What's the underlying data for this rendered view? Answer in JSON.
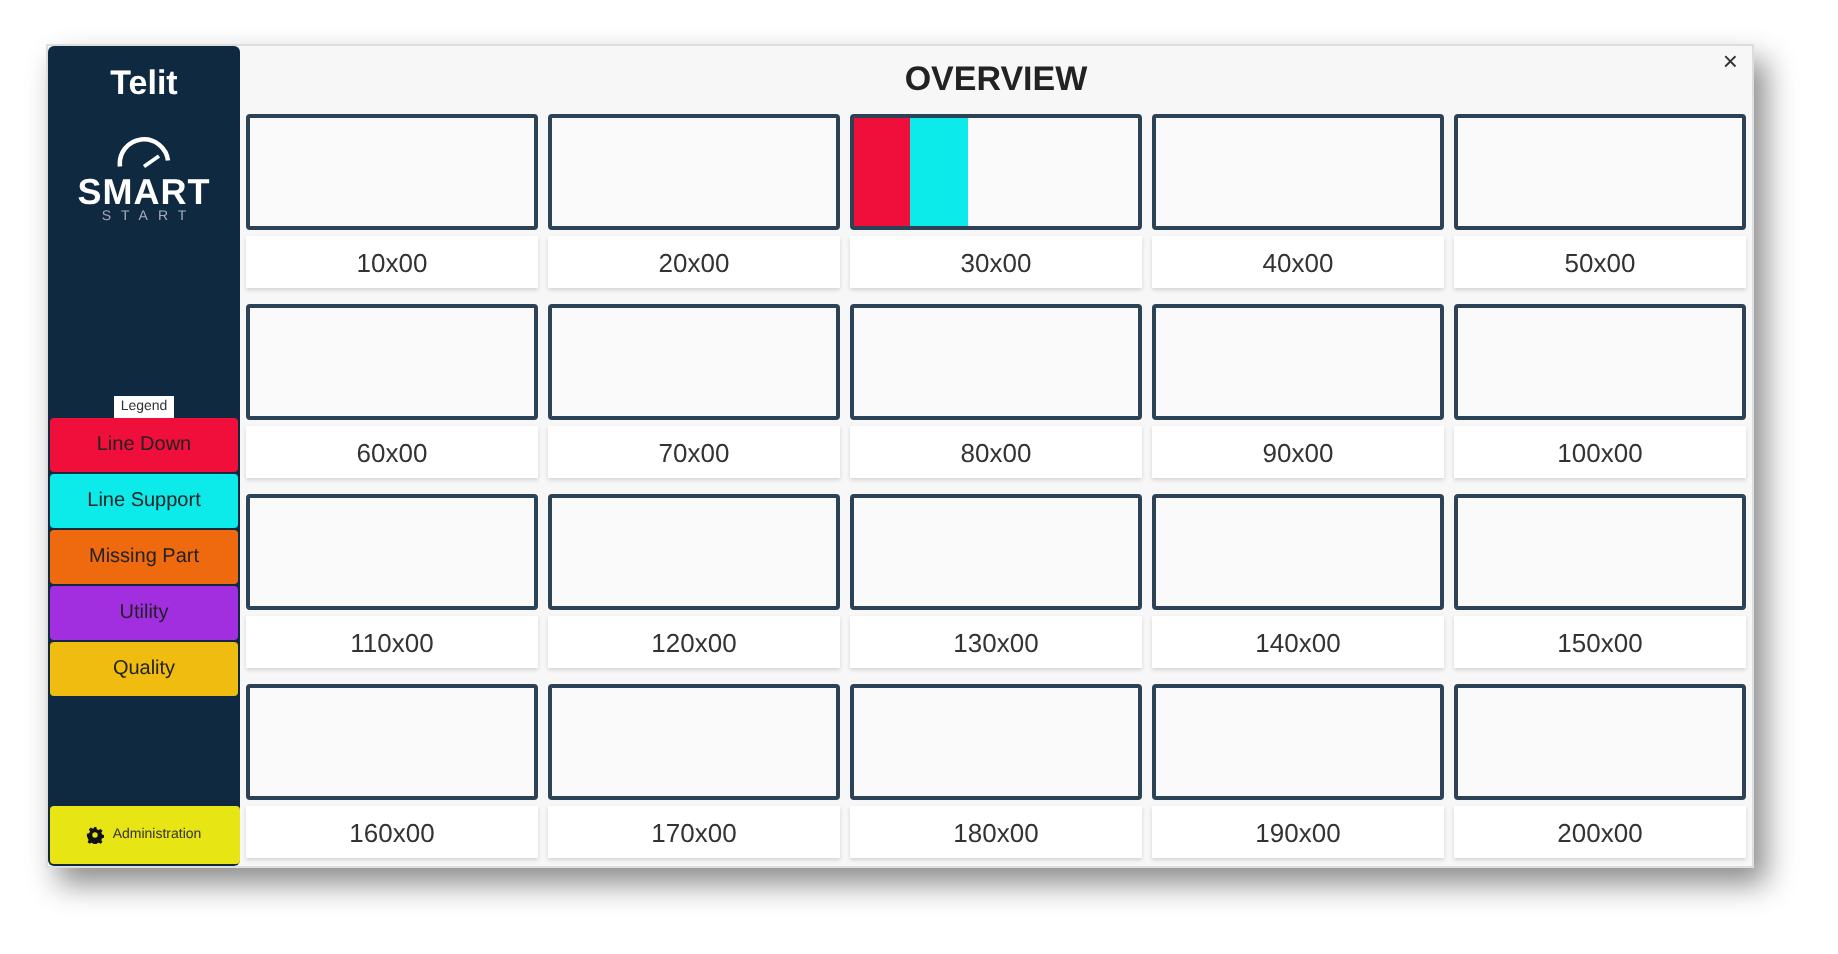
{
  "sidebar": {
    "logo": "Telit",
    "product_title": "SMART",
    "product_subtitle": "START",
    "legend_title": "Legend",
    "legend": [
      {
        "label": "Line Down",
        "color": "#ef0f3a"
      },
      {
        "label": "Line Support",
        "color": "#0ceaea"
      },
      {
        "label": "Missing Part",
        "color": "#ef6a0f"
      },
      {
        "label": "Utility",
        "color": "#a12fe0"
      },
      {
        "label": "Quality",
        "color": "#efbc0f"
      }
    ],
    "admin_button": "Administration"
  },
  "title": "OVERVIEW",
  "close": "×",
  "lines": [
    {
      "name": "10x00"
    },
    {
      "name": "20x00"
    },
    {
      "name": "30x00",
      "segments": [
        {
          "color": "#ef0f3a"
        },
        {
          "color": "#0ceaea"
        }
      ]
    },
    {
      "name": "40x00"
    },
    {
      "name": "50x00"
    },
    {
      "name": "60x00"
    },
    {
      "name": "70x00"
    },
    {
      "name": "80x00"
    },
    {
      "name": "90x00"
    },
    {
      "name": "100x00"
    },
    {
      "name": "110x00"
    },
    {
      "name": "120x00"
    },
    {
      "name": "130x00"
    },
    {
      "name": "140x00"
    },
    {
      "name": "150x00"
    },
    {
      "name": "160x00"
    },
    {
      "name": "170x00"
    },
    {
      "name": "180x00"
    },
    {
      "name": "190x00"
    },
    {
      "name": "200x00"
    }
  ]
}
